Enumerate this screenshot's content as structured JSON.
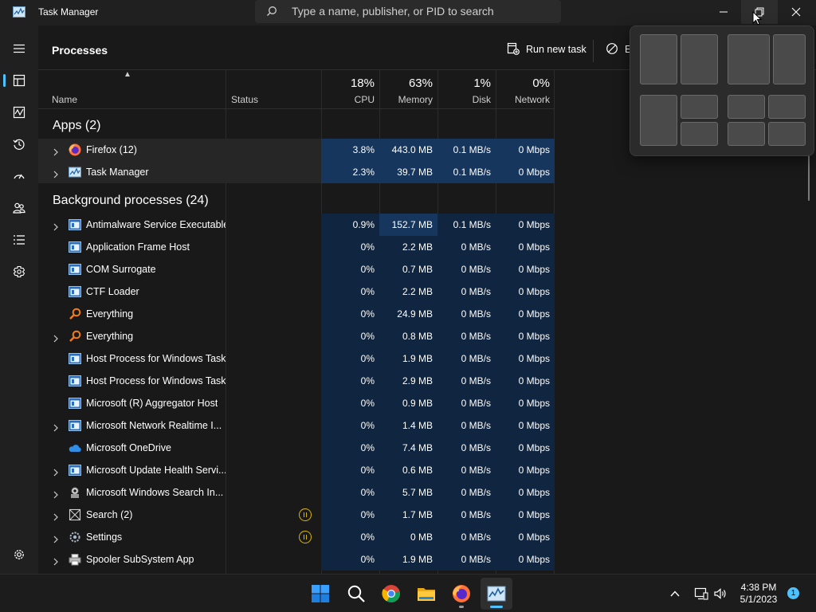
{
  "app": {
    "title": "Task Manager",
    "search_placeholder": "Type a name, publisher, or PID to search"
  },
  "colors": {
    "accent": "#4cc2ff",
    "heat_low": "#10253f",
    "heat_high": "#17365d",
    "efficiency_status": "#d9b600"
  },
  "nav": {
    "items": [
      {
        "icon": "hamburger-menu-icon"
      },
      {
        "icon": "processes-icon",
        "active": true
      },
      {
        "icon": "performance-icon"
      },
      {
        "icon": "app-history-icon"
      },
      {
        "icon": "startup-apps-icon"
      },
      {
        "icon": "users-icon"
      },
      {
        "icon": "details-icon"
      },
      {
        "icon": "services-icon"
      }
    ],
    "settings_icon": "gear-icon"
  },
  "page": {
    "title": "Processes",
    "run_new_task": "Run new task",
    "end_task_truncated": "E"
  },
  "columns": {
    "name": "Name",
    "status": "Status",
    "cpu": {
      "label": "CPU",
      "pct": "18%"
    },
    "memory": {
      "label": "Memory",
      "pct": "63%"
    },
    "disk": {
      "label": "Disk",
      "pct": "1%"
    },
    "network": {
      "label": "Network",
      "pct": "0%"
    }
  },
  "groups": {
    "apps": "Apps (2)",
    "background": "Background processes (24)"
  },
  "apps": [
    {
      "name": "Firefox (12)",
      "icon": "firefox-icon",
      "expandable": true,
      "cpu": "3.8%",
      "memory": "443.0 MB",
      "disk": "0.1 MB/s",
      "network": "0 Mbps"
    },
    {
      "name": "Task Manager",
      "icon": "task-manager-icon",
      "expandable": true,
      "cpu": "2.3%",
      "memory": "39.7 MB",
      "disk": "0.1 MB/s",
      "network": "0 Mbps"
    }
  ],
  "background": [
    {
      "name": "Antimalware Service Executable",
      "icon": "service-window-icon",
      "expandable": true,
      "cpu": "0.9%",
      "memory": "152.7 MB",
      "disk": "0.1 MB/s",
      "network": "0 Mbps",
      "mem_high": true
    },
    {
      "name": "Application Frame Host",
      "icon": "service-window-icon",
      "expandable": false,
      "cpu": "0%",
      "memory": "2.2 MB",
      "disk": "0 MB/s",
      "network": "0 Mbps"
    },
    {
      "name": "COM Surrogate",
      "icon": "service-window-icon",
      "expandable": false,
      "cpu": "0%",
      "memory": "0.7 MB",
      "disk": "0 MB/s",
      "network": "0 Mbps"
    },
    {
      "name": "CTF Loader",
      "icon": "service-window-icon",
      "expandable": false,
      "cpu": "0%",
      "memory": "2.2 MB",
      "disk": "0 MB/s",
      "network": "0 Mbps"
    },
    {
      "name": "Everything",
      "icon": "everything-search-icon",
      "expandable": false,
      "cpu": "0%",
      "memory": "24.9 MB",
      "disk": "0 MB/s",
      "network": "0 Mbps"
    },
    {
      "name": "Everything",
      "icon": "everything-search-icon",
      "expandable": true,
      "cpu": "0%",
      "memory": "0.8 MB",
      "disk": "0 MB/s",
      "network": "0 Mbps"
    },
    {
      "name": "Host Process for Windows Tasks",
      "icon": "service-window-icon",
      "expandable": false,
      "cpu": "0%",
      "memory": "1.9 MB",
      "disk": "0 MB/s",
      "network": "0 Mbps"
    },
    {
      "name": "Host Process for Windows Tasks",
      "icon": "service-window-icon",
      "expandable": false,
      "cpu": "0%",
      "memory": "2.9 MB",
      "disk": "0 MB/s",
      "network": "0 Mbps"
    },
    {
      "name": "Microsoft (R) Aggregator Host",
      "icon": "service-window-icon",
      "expandable": false,
      "cpu": "0%",
      "memory": "0.9 MB",
      "disk": "0 MB/s",
      "network": "0 Mbps"
    },
    {
      "name": "Microsoft Network Realtime I...",
      "icon": "service-window-icon",
      "expandable": true,
      "cpu": "0%",
      "memory": "1.4 MB",
      "disk": "0 MB/s",
      "network": "0 Mbps"
    },
    {
      "name": "Microsoft OneDrive",
      "icon": "onedrive-cloud-icon",
      "expandable": false,
      "cpu": "0%",
      "memory": "7.4 MB",
      "disk": "0 MB/s",
      "network": "0 Mbps"
    },
    {
      "name": "Microsoft Update Health Servi...",
      "icon": "service-window-icon",
      "expandable": true,
      "cpu": "0%",
      "memory": "0.6 MB",
      "disk": "0 MB/s",
      "network": "0 Mbps"
    },
    {
      "name": "Microsoft Windows Search In...",
      "icon": "search-indexer-icon",
      "expandable": true,
      "cpu": "0%",
      "memory": "5.7 MB",
      "disk": "0 MB/s",
      "network": "0 Mbps"
    },
    {
      "name": "Search (2)",
      "icon": "search-app-icon",
      "expandable": true,
      "status": "efficiency-mode-icon",
      "cpu": "0%",
      "memory": "1.7 MB",
      "disk": "0 MB/s",
      "network": "0 Mbps"
    },
    {
      "name": "Settings",
      "icon": "settings-gear-icon",
      "expandable": true,
      "status": "efficiency-mode-icon",
      "cpu": "0%",
      "memory": "0 MB",
      "disk": "0 MB/s",
      "network": "0 Mbps"
    },
    {
      "name": "Spooler SubSystem App",
      "icon": "printer-icon",
      "expandable": true,
      "cpu": "0%",
      "memory": "1.9 MB",
      "disk": "0 MB/s",
      "network": "0 Mbps"
    }
  ],
  "taskbar": {
    "apps": [
      {
        "icon": "windows-start-icon"
      },
      {
        "icon": "search-icon"
      },
      {
        "icon": "chrome-icon"
      },
      {
        "icon": "file-explorer-icon"
      },
      {
        "icon": "firefox-icon",
        "running": true
      },
      {
        "icon": "task-manager-icon",
        "active": true
      }
    ],
    "tray": {
      "time": "4:38 PM",
      "date": "5/1/2023",
      "notifications": "1"
    }
  }
}
